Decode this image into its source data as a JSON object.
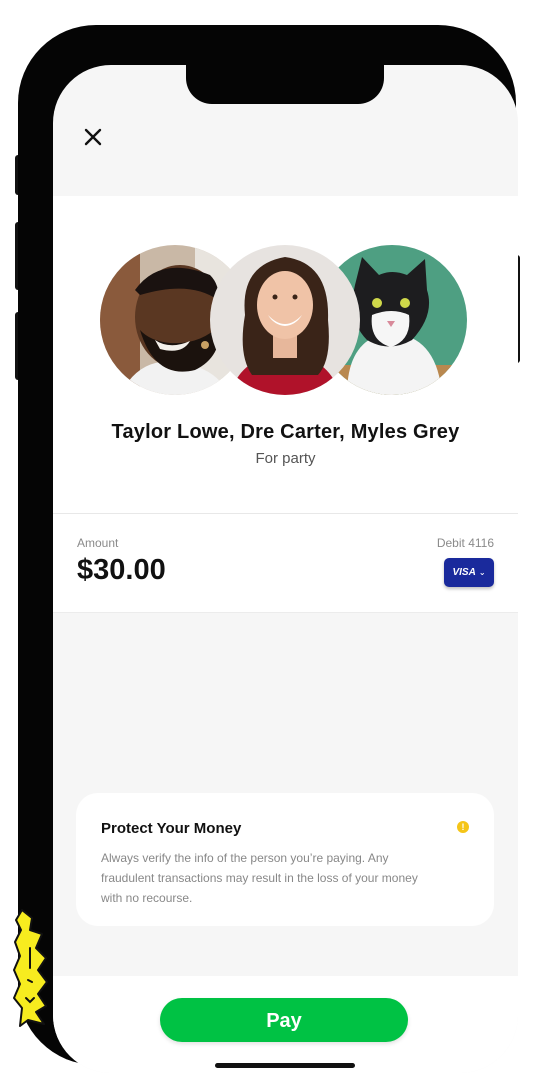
{
  "header": {
    "close_icon": "close-icon"
  },
  "recipients": {
    "names": "Taylor Lowe, Dre Carter, Myles Grey",
    "note": "For party",
    "avatars": [
      "man-avatar",
      "woman-avatar",
      "cat-avatar"
    ]
  },
  "payment": {
    "amount_label": "Amount",
    "amount_value": "$30.00",
    "card_label": "Debit 4116",
    "card_brand": "VISA"
  },
  "protect": {
    "title": "Protect Your Money",
    "body": "Always verify the info of the person you’re paying. Any fraudulent transactions may result in the loss of your money with no recourse.",
    "info_icon": "info-icon"
  },
  "footer": {
    "pay_label": "Pay"
  },
  "colors": {
    "accent_green": "#00c244",
    "visa_blue": "#1a2a9c",
    "info_yellow": "#f5c518",
    "background": "#f6f6f6"
  }
}
